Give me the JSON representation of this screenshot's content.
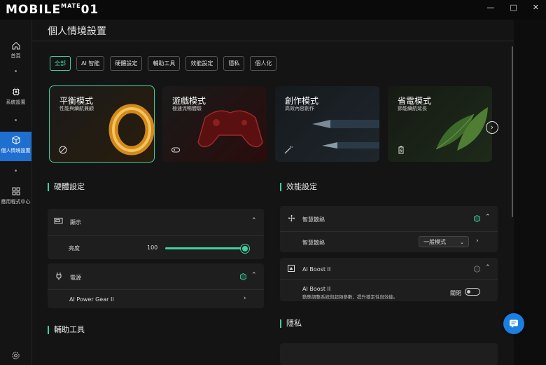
{
  "app": {
    "logo_text": "MOBILE",
    "logo_sup": "MATE",
    "logo_suffix": "01"
  },
  "window": {
    "minimize": "—",
    "maximize": "□",
    "close": "✕"
  },
  "sidebar": {
    "items": [
      {
        "label": "首頁",
        "icon": "home-icon"
      },
      {
        "label": "系統設置",
        "icon": "chip-icon"
      },
      {
        "label": "個人情境設置",
        "icon": "cube-icon",
        "active": true
      },
      {
        "label": "應用程式中心",
        "icon": "grid-icon"
      }
    ],
    "bottom_icon": "gear-icon"
  },
  "header": {
    "title": "個人情境設置"
  },
  "filters": [
    "全部",
    "AI 智能",
    "硬體設定",
    "輔助工具",
    "效能設定",
    "隱私",
    "個人化"
  ],
  "modes": [
    {
      "title": "平衡模式",
      "subtitle": "性能與續航兼顧",
      "icon": "balance-icon",
      "active": true
    },
    {
      "title": "遊戲模式",
      "subtitle": "極速流暢體驗",
      "icon": "gamepad-icon"
    },
    {
      "title": "創作模式",
      "subtitle": "高效內容創作",
      "icon": "magic-wand-icon"
    },
    {
      "title": "省電模式",
      "subtitle": "節能續航延長",
      "icon": "battery-icon"
    }
  ],
  "hardware": {
    "title": "硬體設定",
    "display": {
      "label": "顯示",
      "brightness_label": "亮度",
      "brightness_value": "100",
      "brightness_level": 1.0
    },
    "power": {
      "label": "電源",
      "gear_label": "AI Power Gear II"
    }
  },
  "performance": {
    "title": "效能設定",
    "cooling": {
      "label": "智慧散熱",
      "row_label": "智慧散熱",
      "mode": "一般模式"
    },
    "boost": {
      "label": "AI Boost II",
      "row_title": "AI Boost II",
      "row_desc": "動態調整系統與超頻參數，提升穩定性與效能。",
      "state": "關閉"
    }
  },
  "assist": {
    "title": "輔助工具"
  },
  "privacy": {
    "title": "隱私"
  },
  "colors": {
    "accent": "#3fd1a0",
    "active_nav": "#1f6fd0",
    "fab": "#1a7fe0"
  }
}
